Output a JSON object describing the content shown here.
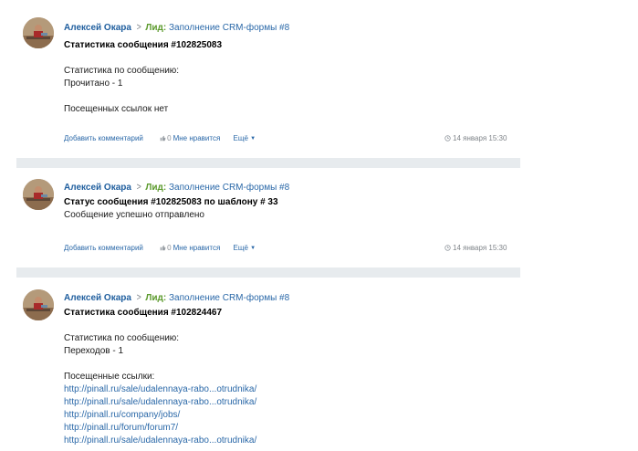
{
  "posts": [
    {
      "author": "Алексей Окара",
      "lead_label": "Лид:",
      "lead_link": "Заполнение CRM-формы #8",
      "title": "Статистика сообщения #102825083",
      "lines": [
        "Статистика по сообщению:",
        "Прочитано - 1",
        "",
        "Посещенных ссылок нет"
      ],
      "links": [],
      "actions": {
        "comment": "Добавить комментарий",
        "like_count": "0",
        "like": "Мне нравится",
        "more": "Ещё"
      },
      "timestamp": "14 января 15:30"
    },
    {
      "author": "Алексей Окара",
      "lead_label": "Лид:",
      "lead_link": "Заполнение CRM-формы #8",
      "title": "Статус сообщения #102825083 по шаблону # 33",
      "lines": [
        "Сообщение успешно отправлено"
      ],
      "links": [],
      "actions": {
        "comment": "Добавить комментарий",
        "like_count": "0",
        "like": "Мне нравится",
        "more": "Ещё"
      },
      "timestamp": "14 января 15:30"
    },
    {
      "author": "Алексей Окара",
      "lead_label": "Лид:",
      "lead_link": "Заполнение CRM-формы #8",
      "title": "Статистика сообщения #102824467",
      "lines": [
        "Статистика по сообщению:",
        "Переходов - 1",
        "",
        "Посещенные ссылки:"
      ],
      "links": [
        "http://pinall.ru/sale/udalennaya-rabo...otrudnika/",
        "http://pinall.ru/sale/udalennaya-rabo...otrudnika/",
        "http://pinall.ru/company/jobs/",
        "http://pinall.ru/forum/forum7/",
        "http://pinall.ru/sale/udalennaya-rabo...otrudnika/"
      ]
    }
  ],
  "icons": {
    "avatar": "user-avatar-photo",
    "chevron": "chevron-right-icon",
    "thumb": "thumbs-up-icon",
    "clock": "clock-icon",
    "caret": "caret-down-icon"
  },
  "colors": {
    "author": "#1f5e9e",
    "lead_label": "#5b9a2c",
    "link": "#2a68a8",
    "muted": "#7f8489",
    "separator": "#e7ebee"
  }
}
